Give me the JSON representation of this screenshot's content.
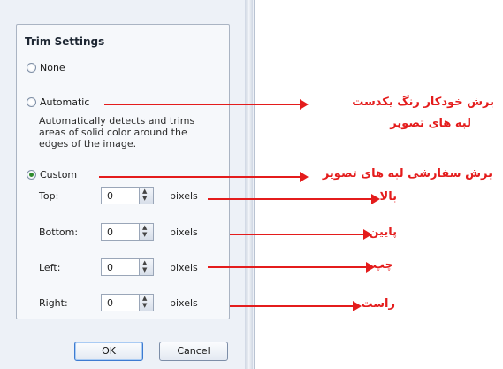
{
  "dialog": {
    "group_title": "Trim Settings",
    "options": {
      "none": "None",
      "automatic": "Automatic",
      "automatic_description": "Automatically detects and trims areas of solid color around the edges of the image.",
      "custom": "Custom",
      "selected": "custom"
    },
    "fields": [
      {
        "label": "Top:",
        "value": "0",
        "unit": "pixels"
      },
      {
        "label": "Bottom:",
        "value": "0",
        "unit": "pixels"
      },
      {
        "label": "Left:",
        "value": "0",
        "unit": "pixels"
      },
      {
        "label": "Right:",
        "value": "0",
        "unit": "pixels"
      }
    ],
    "buttons": {
      "ok": "OK",
      "cancel": "Cancel"
    }
  },
  "annotations": {
    "automatic_line1": "برش خودکار  رنگ یکدست",
    "automatic_line2": "لبه های تصویر",
    "custom": "برش سفارشی لبه های تصویر",
    "top": "بالا",
    "bottom": "پایین",
    "left": "چپ",
    "right": "راست",
    "color": "#e41c1c"
  },
  "icons": {
    "spin_up": "spin-up-icon",
    "spin_down": "spin-down-icon",
    "annotation_arrow": "arrow-right-icon"
  }
}
